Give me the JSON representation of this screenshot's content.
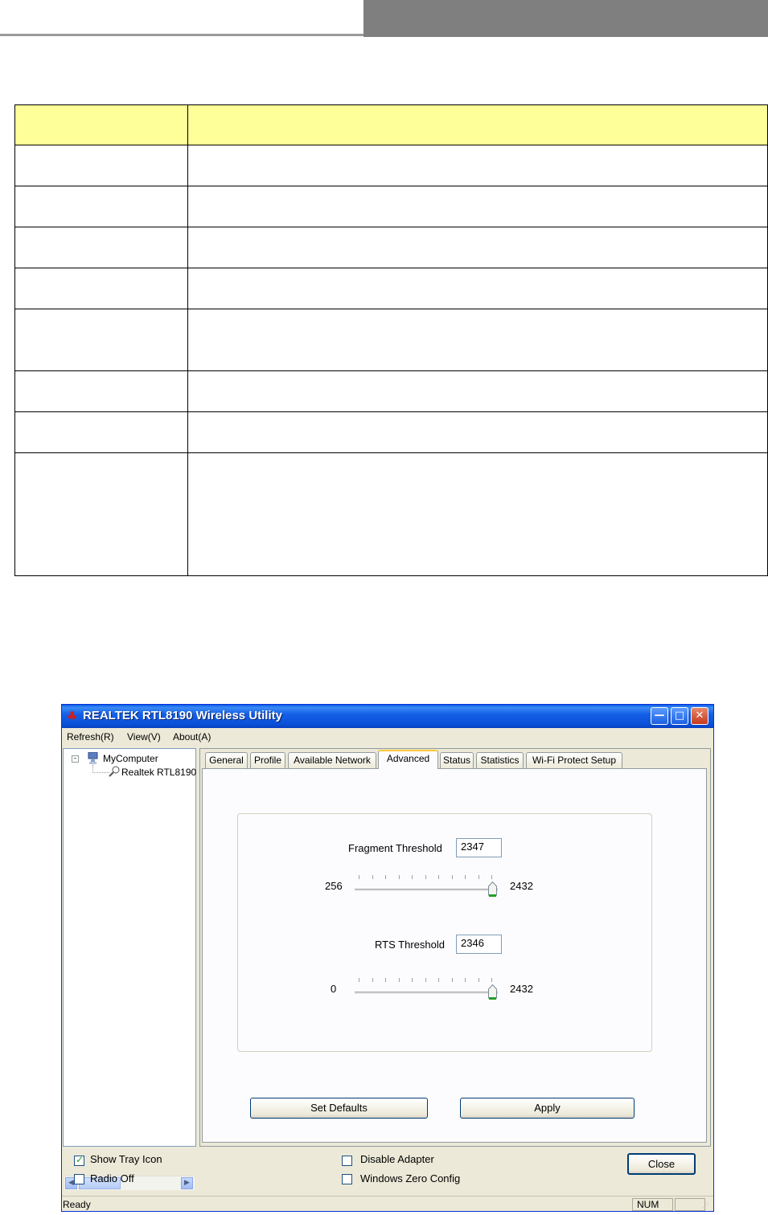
{
  "window": {
    "title": "REALTEK RTL8190 Wireless Utility",
    "menu": [
      "Refresh(R)",
      "View(V)",
      "About(A)"
    ]
  },
  "tree": {
    "root": "MyComputer",
    "child": "Realtek RTL8190"
  },
  "tabs": [
    "General",
    "Profile",
    "Available Network",
    "Advanced",
    "Status",
    "Statistics",
    "Wi-Fi Protect Setup"
  ],
  "active_tab": "Advanced",
  "advanced": {
    "fragment": {
      "label": "Fragment Threshold",
      "value": "2347",
      "min": "256",
      "max": "2432",
      "level": 0.9615
    },
    "rts": {
      "label": "RTS Threshold",
      "value": "2346",
      "min": "0",
      "max": "2432",
      "level": 0.9646
    },
    "set_defaults": "Set Defaults",
    "apply": "Apply"
  },
  "options": {
    "show_tray_icon": {
      "label": "Show Tray Icon",
      "checked": true
    },
    "radio_off": {
      "label": "Radio Off",
      "checked": false
    },
    "disable_adapter": {
      "label": "Disable Adapter",
      "checked": false
    },
    "windows_zero_config": {
      "label": "Windows Zero Config",
      "checked": false
    }
  },
  "close_label": "Close",
  "status": {
    "text": "Ready",
    "num": "NUM"
  },
  "colors": {
    "table_header": "#ffff99",
    "titlebar": "#0a5ce6",
    "header_bar": "#7f7f7f"
  }
}
